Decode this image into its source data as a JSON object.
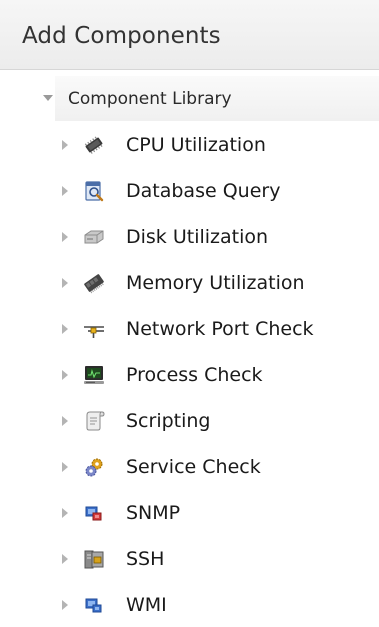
{
  "panel": {
    "title": "Add Components"
  },
  "tree": {
    "root_label": "Component Library",
    "items": [
      {
        "label": "CPU Utilization",
        "icon": "cpu-chip-icon"
      },
      {
        "label": "Database Query",
        "icon": "database-query-icon"
      },
      {
        "label": "Disk Utilization",
        "icon": "disk-drive-icon"
      },
      {
        "label": "Memory Utilization",
        "icon": "memory-module-icon"
      },
      {
        "label": "Network Port Check",
        "icon": "network-port-icon"
      },
      {
        "label": "Process Check",
        "icon": "process-monitor-icon"
      },
      {
        "label": "Scripting",
        "icon": "script-scroll-icon"
      },
      {
        "label": "Service Check",
        "icon": "service-gears-icon"
      },
      {
        "label": "SNMP",
        "icon": "snmp-network-icon"
      },
      {
        "label": "SSH",
        "icon": "ssh-server-icon"
      },
      {
        "label": "WMI",
        "icon": "wmi-network-icon"
      }
    ]
  }
}
